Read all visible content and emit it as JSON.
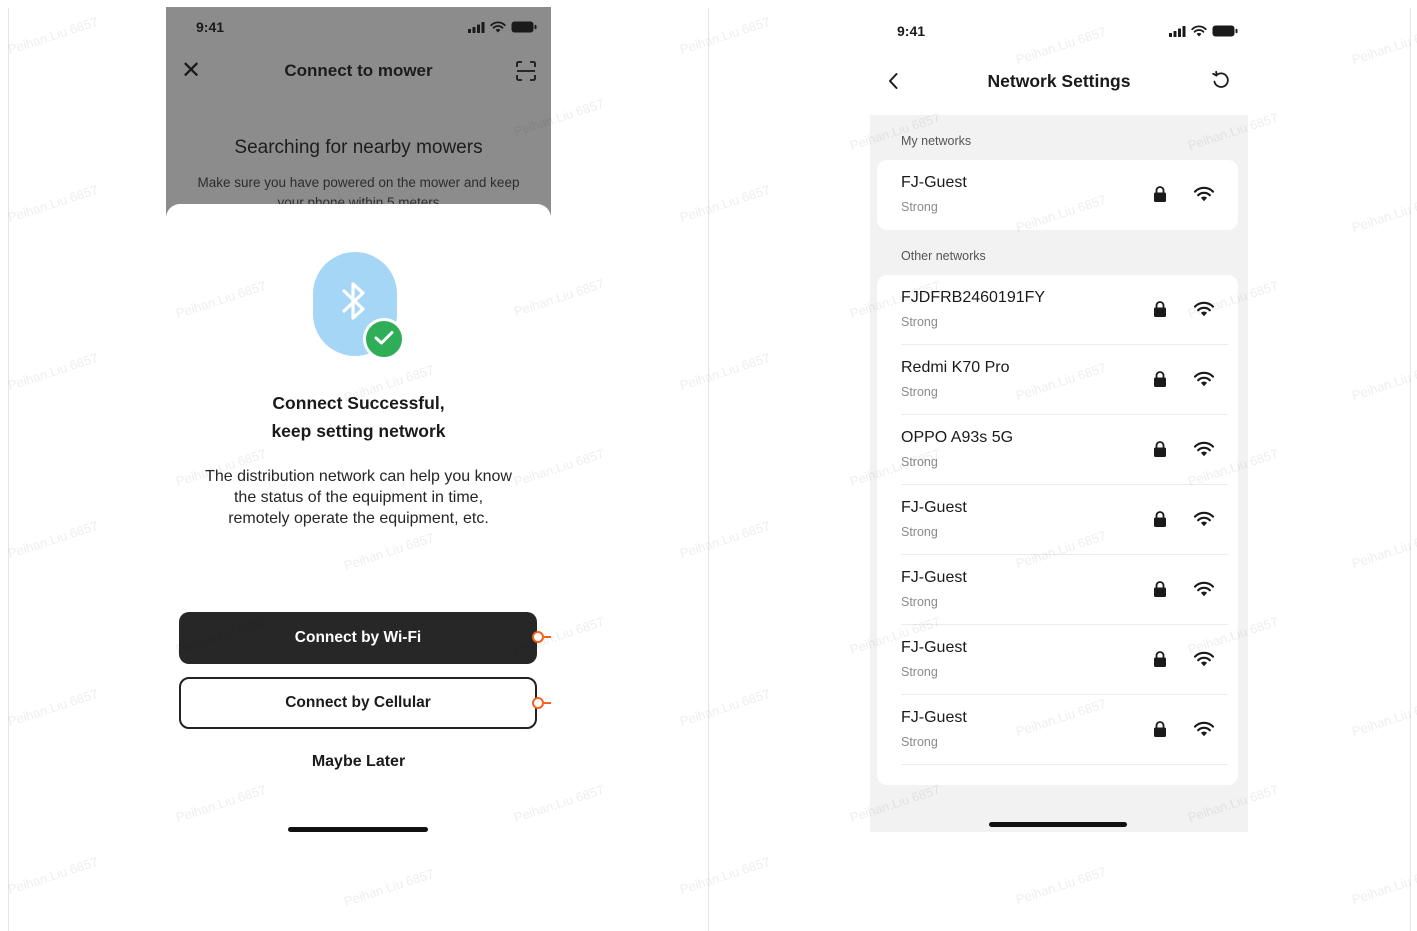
{
  "status_bar": {
    "time": "9:41"
  },
  "left_screen": {
    "header_title": "Connect to mower",
    "search_title": "Searching for nearby mowers",
    "search_subtitle": "Make sure you have powered on the mower and keep your phone within 5 meters",
    "success_title_line1": "Connect Successful,",
    "success_title_line2": "keep setting network",
    "description_line1": "The distribution network can help you know",
    "description_line2": "the status of the equipment in time,",
    "description_line3": "remotely operate the equipment, etc.",
    "btn_wifi": "Connect by Wi-Fi",
    "btn_cellular": "Connect by Cellular",
    "maybe_later": "Maybe Later"
  },
  "right_screen": {
    "header_title": "Network Settings",
    "my_networks_label": "My networks",
    "other_networks_label": "Other networks",
    "my_networks": [
      {
        "name": "FJ-Guest",
        "strength": "Strong"
      }
    ],
    "other_networks": [
      {
        "name": "FJDFRB2460191FY",
        "strength": "Strong"
      },
      {
        "name": "Redmi K70 Pro",
        "strength": "Strong"
      },
      {
        "name": "OPPO A93s 5G",
        "strength": "Strong"
      },
      {
        "name": "FJ-Guest",
        "strength": "Strong"
      },
      {
        "name": "FJ-Guest",
        "strength": "Strong"
      },
      {
        "name": "FJ-Guest",
        "strength": "Strong"
      },
      {
        "name": "FJ-Guest",
        "strength": "Strong"
      }
    ]
  },
  "watermark": "Peihan.Liu 6857",
  "colors": {
    "accent_orange": "#f2641f",
    "success_green": "#2fae57",
    "bluetooth_bg": "#a6d6f5",
    "primary_button": "#272727"
  }
}
